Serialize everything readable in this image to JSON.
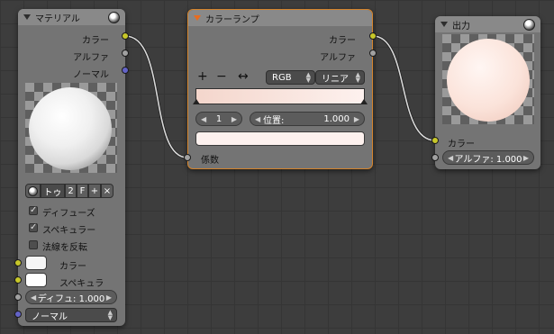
{
  "material_node": {
    "title": "マテリアル",
    "outputs": {
      "color": "カラー",
      "alpha": "アルファ",
      "normal": "ノーマル"
    },
    "material_bar": {
      "name": "トゥ",
      "users": "2",
      "fake_user": "F",
      "add": "+",
      "remove": "×"
    },
    "options": [
      {
        "label": "ディフューズ",
        "checked": true
      },
      {
        "label": "スペキュラー",
        "checked": true
      },
      {
        "label": "法線を反転",
        "checked": false
      }
    ],
    "inputs": {
      "color": "カラー",
      "specular": "スペキュラ",
      "diffuse_field": "ディフュ: 1.000",
      "normal_dropdown": "ノーマル"
    }
  },
  "colorramp_node": {
    "title": "カラーランプ",
    "outputs": {
      "color": "カラー",
      "alpha": "アルファ"
    },
    "toolbar": {
      "add": "+",
      "remove": "−",
      "flip": "↔",
      "color_mode": "RGB",
      "interpolation": "リニア"
    },
    "active_stop": "1",
    "position_field": "位置:",
    "position_value": "1.000",
    "input_factor": "係数"
  },
  "output_node": {
    "title": "出力",
    "inputs": {
      "color": "カラー",
      "alpha_field": "アルファ: 1.000"
    }
  },
  "colors": {
    "socket_color": "#c7c729",
    "socket_value": "#a1a1a1",
    "socket_vector": "#6363c7",
    "ramp_start": "#f4d6cc",
    "ramp_end": "#fdf1ee",
    "output_preview": "#fbe3da"
  },
  "icons": [
    "collapse-triangle-icon",
    "material-ball-icon",
    "checkbox-icon",
    "dropdown-arrows-icon"
  ]
}
